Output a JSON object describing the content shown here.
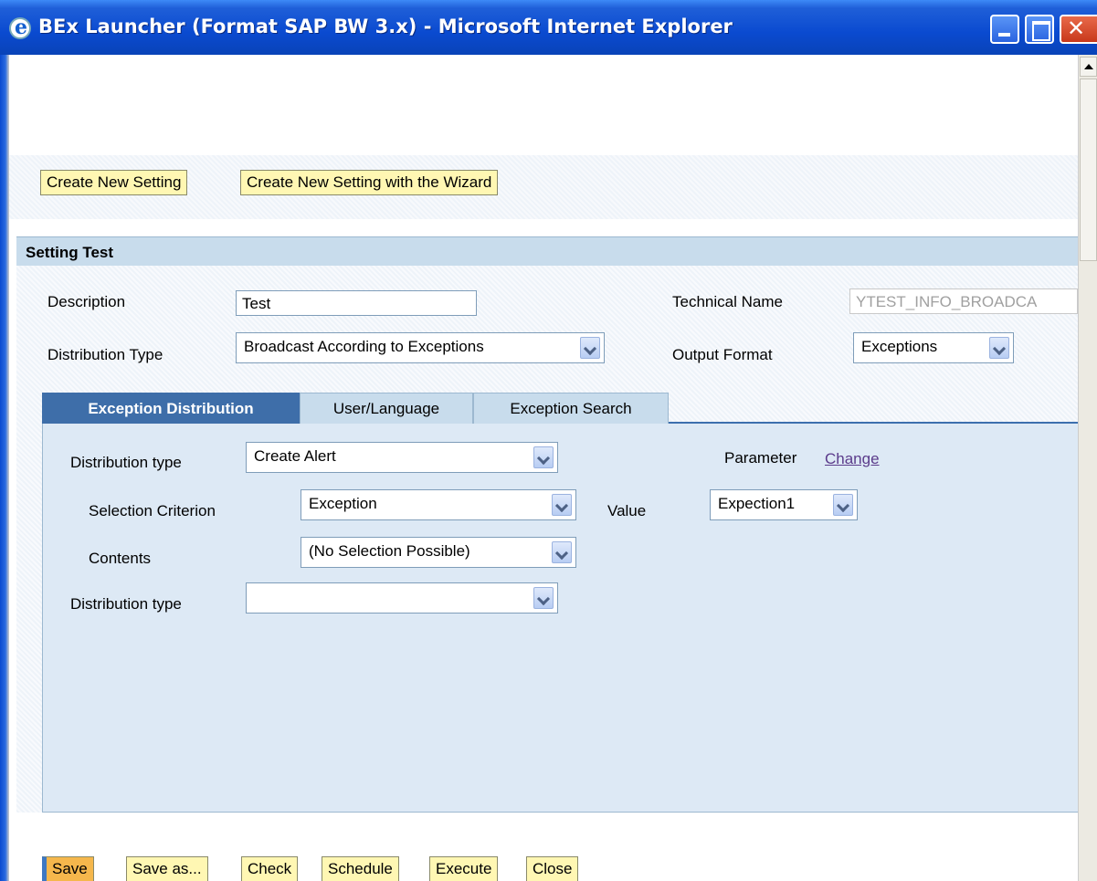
{
  "window": {
    "title": "BEx Launcher (Format SAP BW 3.x) - Microsoft Internet Explorer"
  },
  "top_buttons": {
    "create_new": "Create New Setting",
    "create_wizard": "Create New Setting with the Wizard"
  },
  "setting": {
    "header": "Setting Test",
    "description_label": "Description",
    "description_value": "Test",
    "technical_name_label": "Technical Name",
    "technical_name_value": "YTEST_INFO_BROADCA",
    "distribution_type_label": "Distribution Type",
    "distribution_type_value": "Broadcast According to Exceptions",
    "output_format_label": "Output Format",
    "output_format_value": "Exceptions"
  },
  "tabs": [
    {
      "label": "Exception Distribution",
      "active": true
    },
    {
      "label": "User/Language",
      "active": false
    },
    {
      "label": "Exception Search",
      "active": false
    }
  ],
  "exception_distribution": {
    "dist_type_1_label": "Distribution type",
    "dist_type_1_value": "Create Alert",
    "parameter_label": "Parameter",
    "parameter_link": "Change",
    "selection_criterion_label": "Selection Criterion",
    "selection_criterion_value": "Exception",
    "value_label": "Value",
    "value_value": "Expection1",
    "contents_label": "Contents",
    "contents_value": "(No Selection Possible)",
    "dist_type_2_label": "Distribution type",
    "dist_type_2_value": ""
  },
  "bottom_buttons": {
    "save": "Save",
    "save_as": "Save as...",
    "check": "Check",
    "schedule": "Schedule",
    "execute": "Execute",
    "close": "Close"
  }
}
